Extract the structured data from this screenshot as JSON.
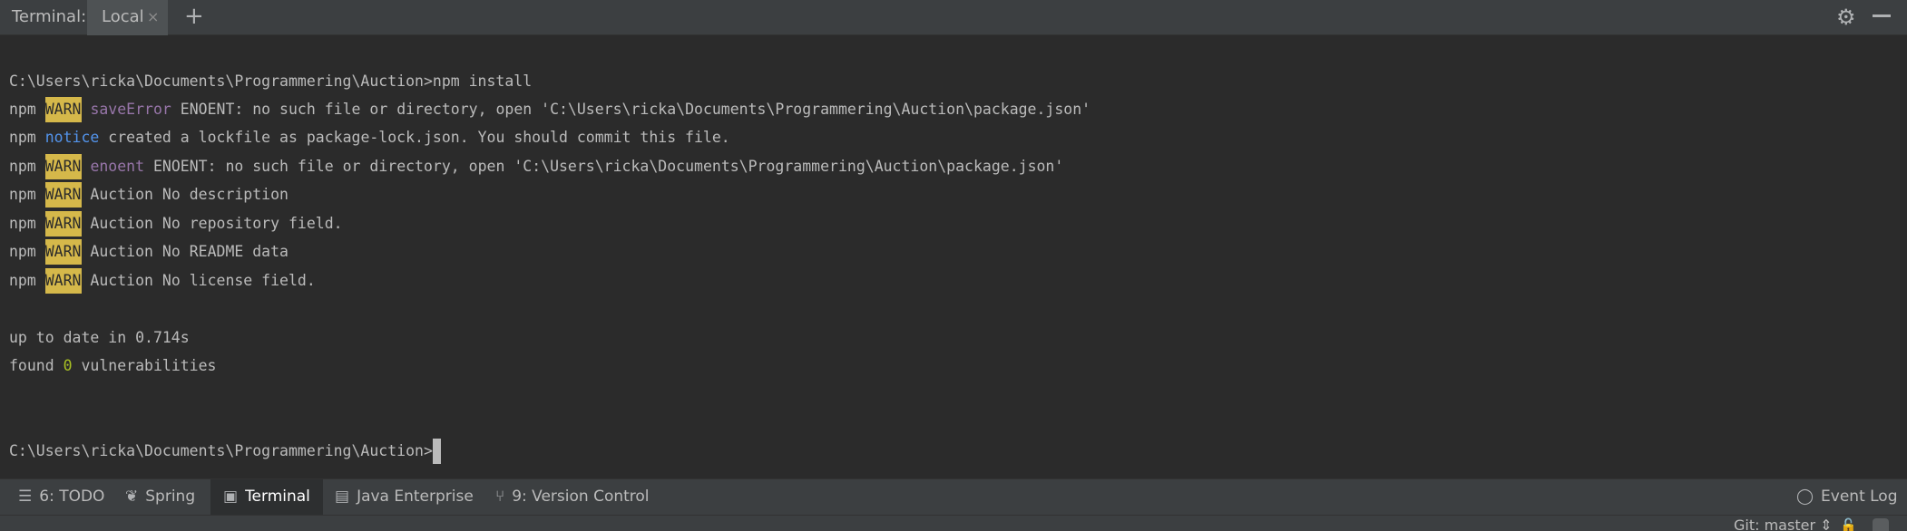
{
  "header": {
    "title": "Terminal:",
    "tab_label": "Local",
    "close_glyph": "×",
    "add_glyph": "+",
    "settings_icon": "gear-icon",
    "minimize_icon": "minimize-icon"
  },
  "terminal": {
    "command_line": "C:\\Users\\ricka\\Documents\\Programmering\\Auction>npm install",
    "npm_prefix": "npm ",
    "warn_label": "WARN",
    "notice_label": "notice",
    "line1_kw": "saveError",
    "line1_rest": " ENOENT: no such file or directory, open 'C:\\Users\\ricka\\Documents\\Programmering\\Auction\\package.json'",
    "line2_rest": " created a lockfile as package-lock.json. You should commit this file.",
    "line3_kw": "enoent",
    "line3_rest": " ENOENT: no such file or directory, open 'C:\\Users\\ricka\\Documents\\Programmering\\Auction\\package.json'",
    "line4_rest": " Auction No description",
    "line5_rest": " Auction No repository field.",
    "line6_rest": " Auction No README data",
    "line7_rest": " Auction No license field.",
    "uptodate": "up to date in 0.714s",
    "found_prefix": "found ",
    "found_count": "0",
    "found_suffix": " vulnerabilities",
    "prompt": "C:\\Users\\ricka\\Documents\\Programmering\\Auction>"
  },
  "toolbar": {
    "todo_label": "6: TODO",
    "spring_label": "Spring",
    "terminal_label": "Terminal",
    "java_label": "Java Enterprise",
    "vcs_label": "9: Version Control",
    "eventlog_label": "Event Log"
  },
  "status": {
    "git_branch": "Git: master ⇕"
  },
  "colors": {
    "warn_bg": "#d5b84a",
    "keyword": "#9876aa",
    "notice": "#5394ec",
    "number": "#a8c023"
  }
}
